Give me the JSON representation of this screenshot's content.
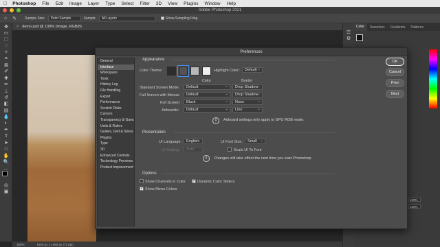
{
  "menubar": {
    "apple": "",
    "app": "Photoshop",
    "items": [
      "File",
      "Edit",
      "Image",
      "Layer",
      "Type",
      "Select",
      "Filter",
      "3D",
      "View",
      "Plugins",
      "Window",
      "Help"
    ]
  },
  "window": {
    "title": "Adobe Photoshop 2021"
  },
  "options": {
    "sample_size_label": "Sample Size:",
    "sample_size_value": "Point Sample",
    "sample_label": "Sample:",
    "sample_value": "All Layers",
    "show_ring_label": "Show Sampling Ring"
  },
  "document": {
    "tab_title": "demo.psd @ 100% (image, RGB/8)",
    "status_zoom": "100%",
    "status_info": "1920 px x 1080 px (72 ppi)"
  },
  "panels": {
    "tabs": [
      "Color",
      "Swatches",
      "Gradients",
      "Patterns"
    ],
    "active_tab": "Color",
    "percent_1": "100%",
    "percent_2": "100%"
  },
  "dialog": {
    "title": "Preferences",
    "categories": [
      "General",
      "Interface",
      "Workspace",
      "Tools",
      "History Log",
      "File Handling",
      "Export",
      "Performance",
      "Scratch Disks",
      "Cursors",
      "Transparency & Gamut",
      "Units & Rulers",
      "Guides, Grid & Slices",
      "Plugins",
      "Type",
      "3D",
      "Enhanced Controls",
      "Technology Previews",
      "Product Improvement"
    ],
    "selected_category": "Interface",
    "appearance": {
      "header": "Appearance",
      "color_theme_label": "Color Theme:",
      "theme_colors": [
        "#2d2d2d",
        "#535353",
        "#b8b8b8",
        "#efefef"
      ],
      "highlight_label": "Highlight Color:",
      "highlight_value": "Default",
      "col_color": "Color",
      "col_border": "Border",
      "rows": [
        {
          "label": "Standard Screen Mode:",
          "color": "Default",
          "border": "Drop Shadow"
        },
        {
          "label": "Full Screen with Menus:",
          "color": "Default",
          "border": "Drop Shadow"
        },
        {
          "label": "Full Screen:",
          "color": "Black",
          "border": "None"
        },
        {
          "label": "Artboards:",
          "color": "Default",
          "border": "Line"
        }
      ],
      "artboard_note": "Artboard settings only apply to GPU RGB mode."
    },
    "presentation": {
      "header": "Presentation",
      "ui_language_label": "UI Language:",
      "ui_language_value": "English",
      "ui_font_size_label": "UI Font Size:",
      "ui_font_size_value": "Small",
      "ui_scaling_label": "UI Scaling:",
      "ui_scaling_value": "Auto",
      "scale_ui_label": "Scale UI To Font",
      "note": "Changes will take effect the next time you start Photoshop."
    },
    "options": {
      "header": "Options",
      "show_channels": "Show Channels in Color",
      "dynamic_sliders": "Dynamic Color Sliders",
      "show_menu_colors": "Show Menu Colors"
    },
    "buttons": {
      "ok": "OK",
      "cancel": "Cancel",
      "prev": "Prev",
      "next": "Next"
    }
  }
}
